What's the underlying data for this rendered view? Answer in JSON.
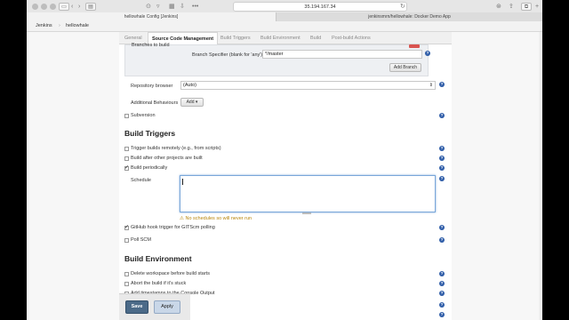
{
  "browser": {
    "url": "35.194.167.34",
    "tabs": [
      "hellowhale Config [Jenkins]",
      "jenkinsmrn/hellowhale: Docker Demo App"
    ]
  },
  "breadcrumb": [
    "Jenkins",
    "hellowhale"
  ],
  "config_tabs": [
    "General",
    "Source Code Management",
    "Build Triggers",
    "Build Environment",
    "Build",
    "Post-build Actions"
  ],
  "scm": {
    "branches_label": "Branches to build",
    "branch_specifier_label": "Branch Specifier (blank for 'any')",
    "branch_specifier_value": "*/master",
    "add_branch": "Add Branch",
    "repo_browser_label": "Repository browser",
    "repo_browser_value": "(Auto)",
    "additional_behaviours_label": "Additional Behaviours",
    "add_label": "Add",
    "subversion_label": "Subversion"
  },
  "build_triggers": {
    "heading": "Build Triggers",
    "remote": "Trigger builds remotely (e.g., from scripts)",
    "after_other": "Build after other projects are built",
    "periodically": "Build periodically",
    "schedule_label": "Schedule",
    "schedule_value": "",
    "warning": "No schedules so will never run",
    "github_hook": "GitHub hook trigger for GITScm polling",
    "poll_scm": "Poll SCM"
  },
  "build_environment": {
    "heading": "Build Environment",
    "delete_workspace": "Delete workspace before build starts",
    "abort_stuck": "Abort the build if it's stuck",
    "add_timestamps": "Add timestamps to the Console Output"
  },
  "actions": {
    "save": "Save",
    "apply": "Apply"
  },
  "help_glyph": "?",
  "colors": {
    "save_button": "#4b6a88",
    "help_icon": "#2f5da8",
    "warning": "#b8860b"
  }
}
